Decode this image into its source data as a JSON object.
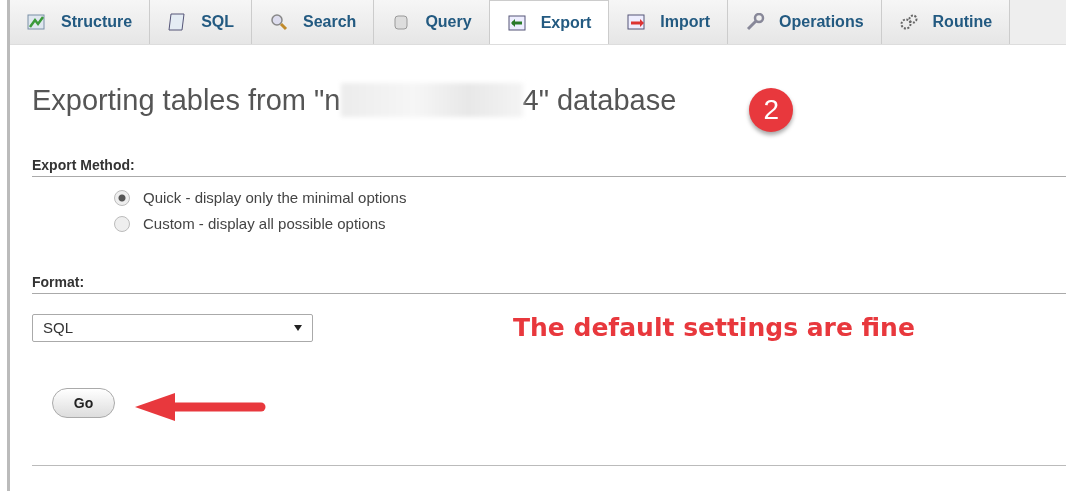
{
  "tabs": [
    {
      "label": "Structure",
      "kind": "structure",
      "selected": false
    },
    {
      "label": "SQL",
      "kind": "sql",
      "selected": false
    },
    {
      "label": "Search",
      "kind": "search",
      "selected": false
    },
    {
      "label": "Query",
      "kind": "query",
      "selected": false
    },
    {
      "label": "Export",
      "kind": "export",
      "selected": true
    },
    {
      "label": "Import",
      "kind": "import",
      "selected": false
    },
    {
      "label": "Operations",
      "kind": "operations",
      "selected": false
    },
    {
      "label": "Routine",
      "kind": "routines",
      "selected": false
    }
  ],
  "heading": {
    "before": "Exporting tables from \"n",
    "after": "4\" database"
  },
  "step_badge": "2",
  "export_method": {
    "legend": "Export Method:",
    "options": [
      {
        "label": "Quick - display only the minimal options",
        "selected": true
      },
      {
        "label": "Custom - display all possible options",
        "selected": false
      }
    ]
  },
  "format": {
    "legend": "Format:",
    "value": "SQL"
  },
  "note": "The default settings are fine",
  "go_button": "Go"
}
